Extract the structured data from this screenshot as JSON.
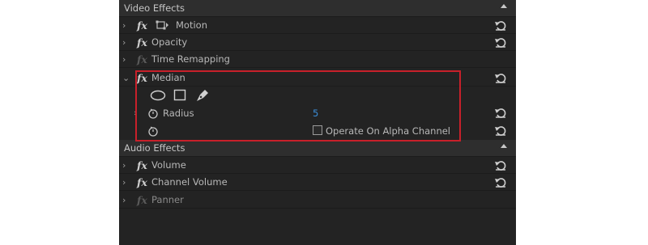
{
  "video_effects": {
    "title": "Video Effects",
    "effects": [
      {
        "fx": "fx",
        "label": "Motion"
      },
      {
        "fx": "fx",
        "label": "Opacity"
      },
      {
        "fx": "fx",
        "label": "Time Remapping"
      },
      {
        "fx": "fx",
        "label": "Median"
      }
    ],
    "median": {
      "radius_label": "Radius",
      "radius_value": "5",
      "alpha_label": "Operate On Alpha Channel",
      "alpha_checked": false
    }
  },
  "audio_effects": {
    "title": "Audio Effects",
    "effects": [
      {
        "fx": "fx",
        "label": "Volume"
      },
      {
        "fx": "fx",
        "label": "Channel Volume"
      },
      {
        "fx": "fx",
        "label": "Panner"
      }
    ]
  },
  "colors": {
    "panel_bg": "#232323",
    "section_bg": "#2e2e2e",
    "value_blue": "#3b8ed9",
    "highlight_red": "#c8202a"
  },
  "icons": [
    "chevron-right-icon",
    "chevron-down-icon",
    "fx-icon",
    "motion-transform-icon",
    "ellipse-mask-icon",
    "rectangle-mask-icon",
    "pen-mask-icon",
    "stopwatch-icon",
    "reset-icon",
    "collapse-up-icon"
  ]
}
